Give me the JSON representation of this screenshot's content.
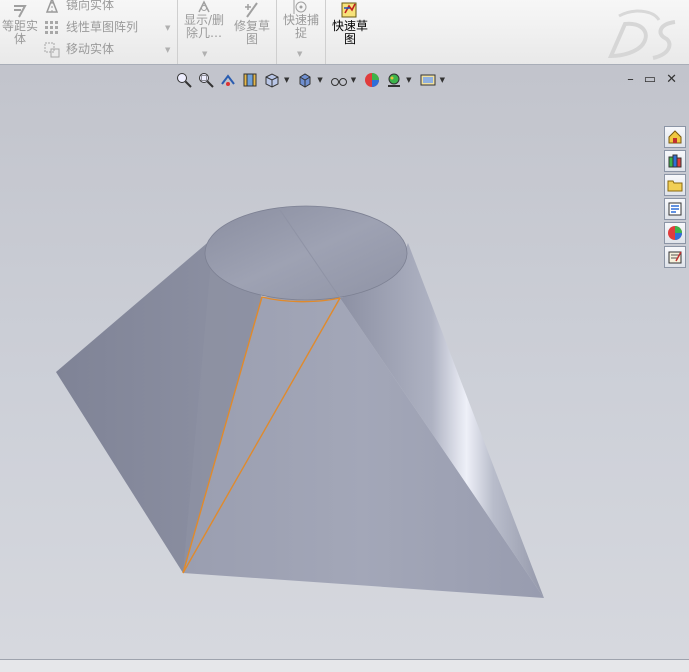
{
  "ribbon": {
    "offset_entities": "等距实\n体",
    "mirror_entities": "镜向实体",
    "linear_sketch_pattern": "线性草图阵列",
    "move_entities": "移动实体",
    "display_delete_relations": "显示/删\n除几…",
    "repair_sketch": "修复草\n图",
    "quick_snaps": "快速捕\n捉",
    "quick_sketch": "快速草\n图"
  },
  "window_buttons": {
    "minimize": "–",
    "restore": "▭",
    "close": "✕"
  },
  "colors": {
    "viewport_bg": "#c9ccd6",
    "model_face": "#9a9eb0",
    "selected_edge": "#e08a2c"
  },
  "icons": {
    "view_toolbar": [
      "zoom-to-fit-icon",
      "zoom-to-area-icon",
      "previous-view-icon",
      "section-view-icon",
      "view-orientation-icon",
      "display-style-icon",
      "hide-show-items-icon",
      "edit-appearance-icon",
      "apply-scene-icon",
      "view-settings-icon"
    ],
    "task_pane": [
      "solidworks-resources-icon",
      "design-library-icon",
      "file-explorer-icon",
      "view-palette-icon",
      "appearances-scenes-icon",
      "custom-properties-icon"
    ]
  }
}
